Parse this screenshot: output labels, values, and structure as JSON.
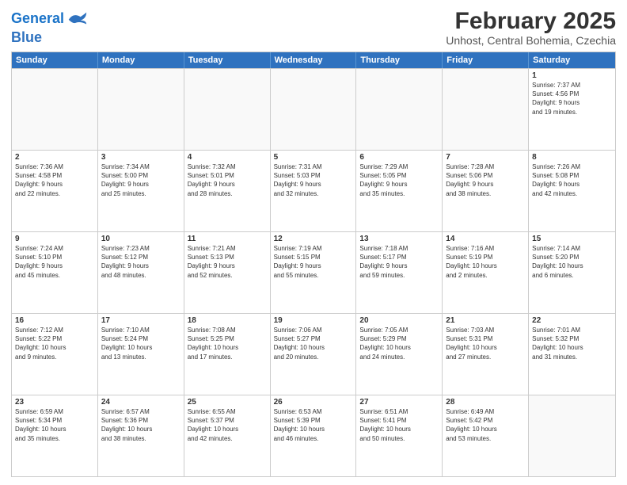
{
  "header": {
    "logo_line1": "General",
    "logo_line2": "Blue",
    "title": "February 2025",
    "subtitle": "Unhost, Central Bohemia, Czechia"
  },
  "weekdays": [
    "Sunday",
    "Monday",
    "Tuesday",
    "Wednesday",
    "Thursday",
    "Friday",
    "Saturday"
  ],
  "weeks": [
    [
      {
        "day": "",
        "info": ""
      },
      {
        "day": "",
        "info": ""
      },
      {
        "day": "",
        "info": ""
      },
      {
        "day": "",
        "info": ""
      },
      {
        "day": "",
        "info": ""
      },
      {
        "day": "",
        "info": ""
      },
      {
        "day": "1",
        "info": "Sunrise: 7:37 AM\nSunset: 4:56 PM\nDaylight: 9 hours\nand 19 minutes."
      }
    ],
    [
      {
        "day": "2",
        "info": "Sunrise: 7:36 AM\nSunset: 4:58 PM\nDaylight: 9 hours\nand 22 minutes."
      },
      {
        "day": "3",
        "info": "Sunrise: 7:34 AM\nSunset: 5:00 PM\nDaylight: 9 hours\nand 25 minutes."
      },
      {
        "day": "4",
        "info": "Sunrise: 7:32 AM\nSunset: 5:01 PM\nDaylight: 9 hours\nand 28 minutes."
      },
      {
        "day": "5",
        "info": "Sunrise: 7:31 AM\nSunset: 5:03 PM\nDaylight: 9 hours\nand 32 minutes."
      },
      {
        "day": "6",
        "info": "Sunrise: 7:29 AM\nSunset: 5:05 PM\nDaylight: 9 hours\nand 35 minutes."
      },
      {
        "day": "7",
        "info": "Sunrise: 7:28 AM\nSunset: 5:06 PM\nDaylight: 9 hours\nand 38 minutes."
      },
      {
        "day": "8",
        "info": "Sunrise: 7:26 AM\nSunset: 5:08 PM\nDaylight: 9 hours\nand 42 minutes."
      }
    ],
    [
      {
        "day": "9",
        "info": "Sunrise: 7:24 AM\nSunset: 5:10 PM\nDaylight: 9 hours\nand 45 minutes."
      },
      {
        "day": "10",
        "info": "Sunrise: 7:23 AM\nSunset: 5:12 PM\nDaylight: 9 hours\nand 48 minutes."
      },
      {
        "day": "11",
        "info": "Sunrise: 7:21 AM\nSunset: 5:13 PM\nDaylight: 9 hours\nand 52 minutes."
      },
      {
        "day": "12",
        "info": "Sunrise: 7:19 AM\nSunset: 5:15 PM\nDaylight: 9 hours\nand 55 minutes."
      },
      {
        "day": "13",
        "info": "Sunrise: 7:18 AM\nSunset: 5:17 PM\nDaylight: 9 hours\nand 59 minutes."
      },
      {
        "day": "14",
        "info": "Sunrise: 7:16 AM\nSunset: 5:19 PM\nDaylight: 10 hours\nand 2 minutes."
      },
      {
        "day": "15",
        "info": "Sunrise: 7:14 AM\nSunset: 5:20 PM\nDaylight: 10 hours\nand 6 minutes."
      }
    ],
    [
      {
        "day": "16",
        "info": "Sunrise: 7:12 AM\nSunset: 5:22 PM\nDaylight: 10 hours\nand 9 minutes."
      },
      {
        "day": "17",
        "info": "Sunrise: 7:10 AM\nSunset: 5:24 PM\nDaylight: 10 hours\nand 13 minutes."
      },
      {
        "day": "18",
        "info": "Sunrise: 7:08 AM\nSunset: 5:25 PM\nDaylight: 10 hours\nand 17 minutes."
      },
      {
        "day": "19",
        "info": "Sunrise: 7:06 AM\nSunset: 5:27 PM\nDaylight: 10 hours\nand 20 minutes."
      },
      {
        "day": "20",
        "info": "Sunrise: 7:05 AM\nSunset: 5:29 PM\nDaylight: 10 hours\nand 24 minutes."
      },
      {
        "day": "21",
        "info": "Sunrise: 7:03 AM\nSunset: 5:31 PM\nDaylight: 10 hours\nand 27 minutes."
      },
      {
        "day": "22",
        "info": "Sunrise: 7:01 AM\nSunset: 5:32 PM\nDaylight: 10 hours\nand 31 minutes."
      }
    ],
    [
      {
        "day": "23",
        "info": "Sunrise: 6:59 AM\nSunset: 5:34 PM\nDaylight: 10 hours\nand 35 minutes."
      },
      {
        "day": "24",
        "info": "Sunrise: 6:57 AM\nSunset: 5:36 PM\nDaylight: 10 hours\nand 38 minutes."
      },
      {
        "day": "25",
        "info": "Sunrise: 6:55 AM\nSunset: 5:37 PM\nDaylight: 10 hours\nand 42 minutes."
      },
      {
        "day": "26",
        "info": "Sunrise: 6:53 AM\nSunset: 5:39 PM\nDaylight: 10 hours\nand 46 minutes."
      },
      {
        "day": "27",
        "info": "Sunrise: 6:51 AM\nSunset: 5:41 PM\nDaylight: 10 hours\nand 50 minutes."
      },
      {
        "day": "28",
        "info": "Sunrise: 6:49 AM\nSunset: 5:42 PM\nDaylight: 10 hours\nand 53 minutes."
      },
      {
        "day": "",
        "info": ""
      }
    ]
  ]
}
